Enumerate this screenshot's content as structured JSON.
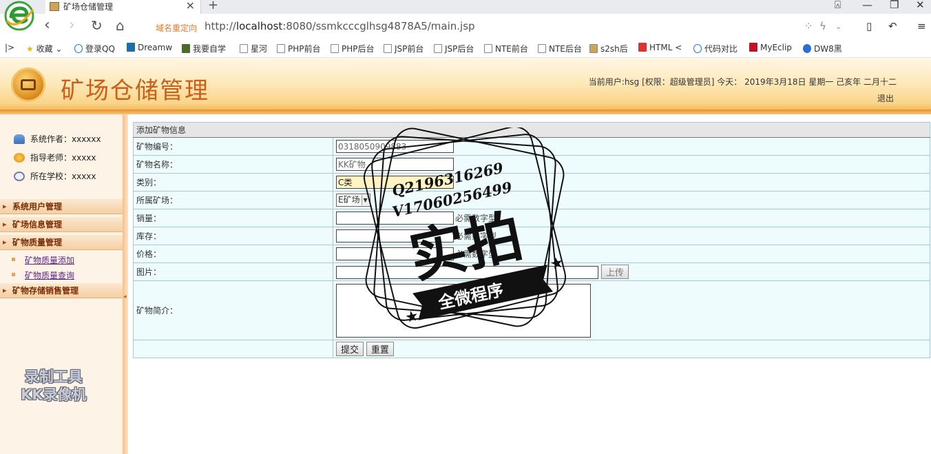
{
  "browser": {
    "tab_title": "矿场仓储管理",
    "new_tab": "+",
    "redirect_label": "域名重定向",
    "url_prefix": "http://",
    "url_host": "localhost",
    "url_rest": ":8080/ssmkcccglhsg4878A5/main.jsp",
    "bookmarks": [
      {
        "label": "收藏"
      },
      {
        "label": "登录QQ"
      },
      {
        "label": "Dreamw"
      },
      {
        "label": "我要自学"
      },
      {
        "label": "星河"
      },
      {
        "label": "PHP前台"
      },
      {
        "label": "PHP后台"
      },
      {
        "label": "JSP前台"
      },
      {
        "label": "JSP后台"
      },
      {
        "label": "NTE前台"
      },
      {
        "label": "NTE后台"
      },
      {
        "label": "s2sh后"
      },
      {
        "label": "HTML <"
      },
      {
        "label": "代码对比"
      },
      {
        "label": "MyEclip"
      },
      {
        "label": "DW8黑"
      }
    ]
  },
  "header": {
    "title": "矿场仓储管理",
    "user_info": "当前用户:hsg [权限：超级管理员] 今天： 2019年3月18日 星期一 己亥年 二月十二",
    "logout": "退出"
  },
  "sidebar": {
    "info": [
      {
        "label": "系统作者：xxxxxx"
      },
      {
        "label": "指导老师：xxxxx"
      },
      {
        "label": "所在学校：xxxxx"
      }
    ],
    "menus": [
      {
        "label": "系统用户管理"
      },
      {
        "label": "矿场信息管理"
      },
      {
        "label": "矿物质量管理"
      },
      {
        "label": "矿物存储销售管理"
      }
    ],
    "sub_items": [
      {
        "label": "矿物质量添加"
      },
      {
        "label": "矿物质量查询"
      }
    ],
    "watermark": [
      "录制工具",
      "KK录像机"
    ]
  },
  "form": {
    "caption": "添加矿物信息",
    "fields": {
      "code": {
        "label": "矿物编号：",
        "value": "0318050909883"
      },
      "name": {
        "label": "矿物名称：",
        "value": "KK矿物"
      },
      "category": {
        "label": "类别：",
        "value": "C类"
      },
      "mine": {
        "label": "所属矿场：",
        "value": "E矿场"
      },
      "sales": {
        "label": "销量：",
        "hint": "必需数字型"
      },
      "stock": {
        "label": "库存：",
        "hint": "必需数字型"
      },
      "price": {
        "label": "价格：",
        "hint": "必需数字型"
      },
      "image": {
        "label": "图片：",
        "upload": "上传"
      },
      "intro": {
        "label": "矿物简介："
      }
    },
    "submit": "提交",
    "reset": "重置"
  },
  "stamp": {
    "line1": "Q2196316269",
    "line2": "V17060256499",
    "big": "实拍",
    "banner": "全微程序"
  }
}
